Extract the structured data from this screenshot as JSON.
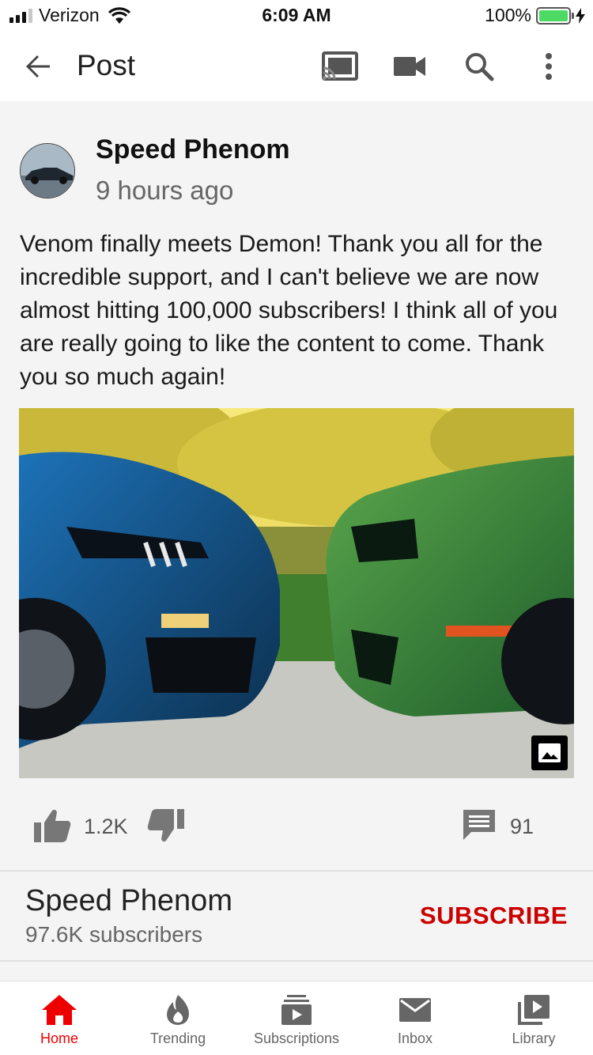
{
  "status_bar": {
    "carrier": "Verizon",
    "time": "6:09 AM",
    "battery": "100%",
    "battery_level": 1.0,
    "signal_bars": 3
  },
  "header": {
    "title": "Post",
    "icons": [
      "back-arrow-icon",
      "cast-icon",
      "video-camera-icon",
      "search-icon",
      "more-vert-icon"
    ]
  },
  "post": {
    "author": "Speed Phenom",
    "time_ago": "9 hours ago",
    "text": "Venom finally meets Demon! Thank you all for the incredible support, and I can't believe we are now almost hitting 100,000 subscribers! I think all of you are really going to like the content to come. Thank you so much again!",
    "likes": "1.2K",
    "comments": "91"
  },
  "channel": {
    "name": "Speed Phenom",
    "subscribers": "97.6K subscribers",
    "subscribe_label": "SUBSCRIBE"
  },
  "nav": {
    "items": [
      {
        "label": "Home",
        "icon": "home-icon",
        "active": true
      },
      {
        "label": "Trending",
        "icon": "flame-icon",
        "active": false
      },
      {
        "label": "Subscriptions",
        "icon": "subscriptions-icon",
        "active": false
      },
      {
        "label": "Inbox",
        "icon": "mail-icon",
        "active": false
      },
      {
        "label": "Library",
        "icon": "library-icon",
        "active": false
      }
    ]
  },
  "colors": {
    "accent_red": "#cc0000",
    "nav_active": "#ee0000",
    "battery_green": "#4cd964"
  }
}
